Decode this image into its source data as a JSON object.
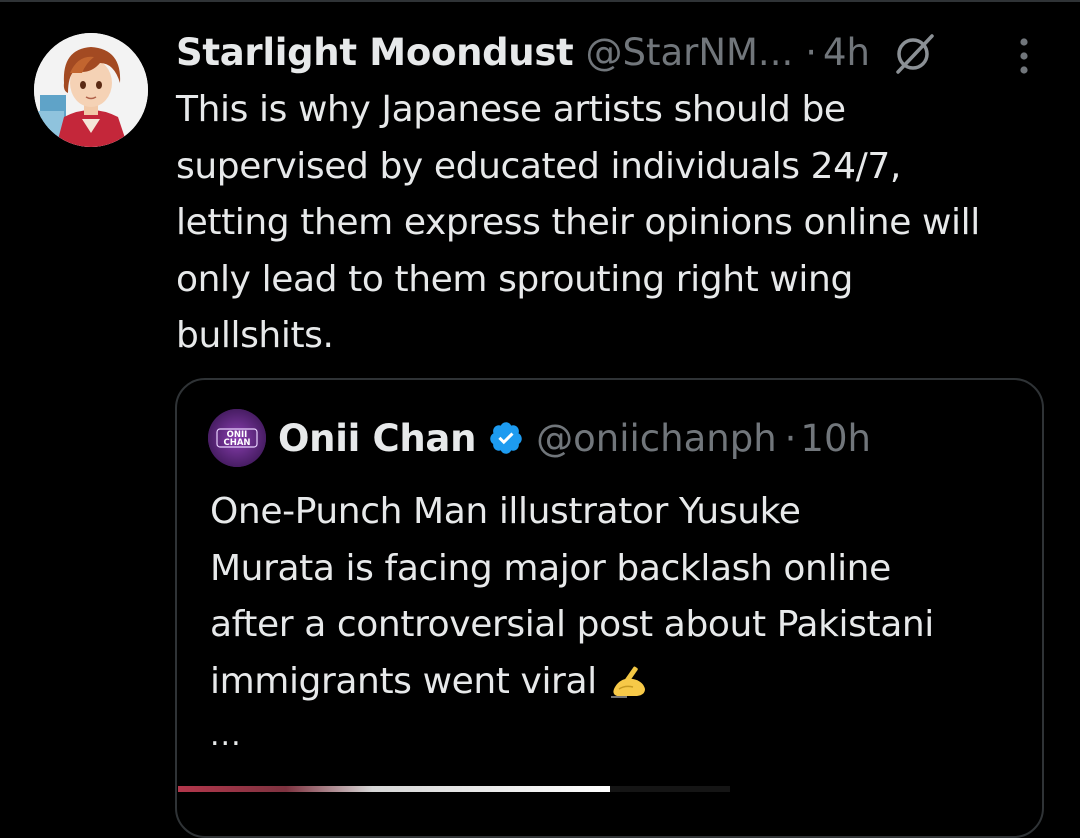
{
  "tweet": {
    "display_name": "Starlight Moondust",
    "handle": "@StarNM...",
    "separator": "·",
    "time": "4h",
    "text": "This is why Japanese artists should be\nsupervised by educated individuals 24/7,\nletting them express their opinions online will\nonly lead to them sprouting right wing\nbullshits."
  },
  "quote": {
    "display_name": "Onii Chan",
    "handle": "@oniichanph",
    "separator": "·",
    "time": "10h",
    "lines": [
      "One-Punch Man illustrator Yusuke",
      "Murata is facing major backlash online",
      "after a controversial post about Pakistani",
      "immigrants went viral"
    ],
    "emoji": "✍",
    "truncation": "...",
    "avatar_text": "ONII CHAN"
  },
  "icons": {
    "grok": "grok-icon",
    "more": "more-icon",
    "verified": "verified-badge-icon",
    "writing_hand": "writing-hand-icon"
  },
  "colors": {
    "background": "#000000",
    "text": "#e7e9ea",
    "secondary_text": "#71767b",
    "border": "#2f3336",
    "verified": "#1d9bf0"
  }
}
